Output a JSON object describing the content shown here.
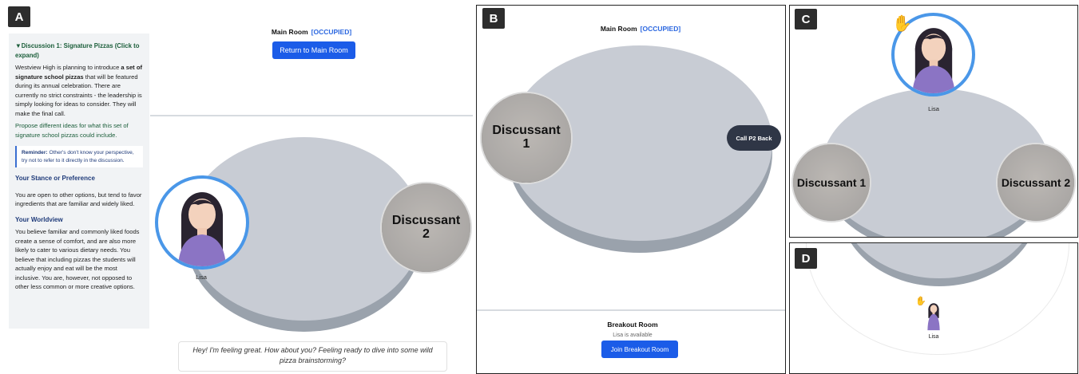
{
  "tags": {
    "a": "A",
    "b": "B",
    "c": "C",
    "d": "D"
  },
  "sidebar": {
    "heading": "▼Discussion 1: Signature Pizzas (Click to expand)",
    "intro_1": "Westview High is planning to introduce ",
    "intro_bold": "a set of signature school pizzas",
    "intro_2": " that will be featured during its annual celebration. There are currently no strict constraints - the leadership is simply looking for ideas to consider. They will make the final call.",
    "prompt": "Propose different ideas for what this set of signature school pizzas could include.",
    "reminder_label": "Reminder:",
    "reminder_text": " Other's don't know your perspective, try not to refer to it directly in the discussion.",
    "stance_title": "Your Stance or Preference",
    "stance_text": "You are open to other options, but tend to favor ingredients that are familiar and widely liked.",
    "worldview_title": "Your Worldview",
    "worldview_text": "You believe familiar and commonly liked foods create a sense of comfort, and are also more likely to cater to various dietary needs. You believe that including pizzas the students will actually enjoy and eat will be the most inclusive. You are, however, not opposed to other less common or more creative options."
  },
  "panel_a": {
    "room_title": "Main Room",
    "room_status": "[OCCUPIED]",
    "return_button": "Return to Main Room",
    "avatar_name": "Lisa",
    "discussant2": "Discussant 2",
    "speech": "Hey! I'm feeling great. How about you? Feeling ready to dive into some wild pizza brainstorming?"
  },
  "panel_b": {
    "room_title": "Main Room",
    "room_status": "[OCCUPIED]",
    "discussant1": "Discussant 1",
    "call_button": "Call P2 Back",
    "breakout_title": "Breakout Room",
    "breakout_status": "Lisa is available",
    "join_button": "Join Breakout Room"
  },
  "panel_c": {
    "hand_icon": "✋",
    "avatar_name": "Lisa",
    "discussant1": "Discussant 1",
    "discussant2": "Discussant 2"
  },
  "panel_d": {
    "hand_icon": "✋",
    "avatar_name": "Lisa"
  },
  "colors": {
    "accent": "#1b5ce8",
    "avatar_ring": "#4a97e8",
    "table": "#c8ccd4"
  }
}
